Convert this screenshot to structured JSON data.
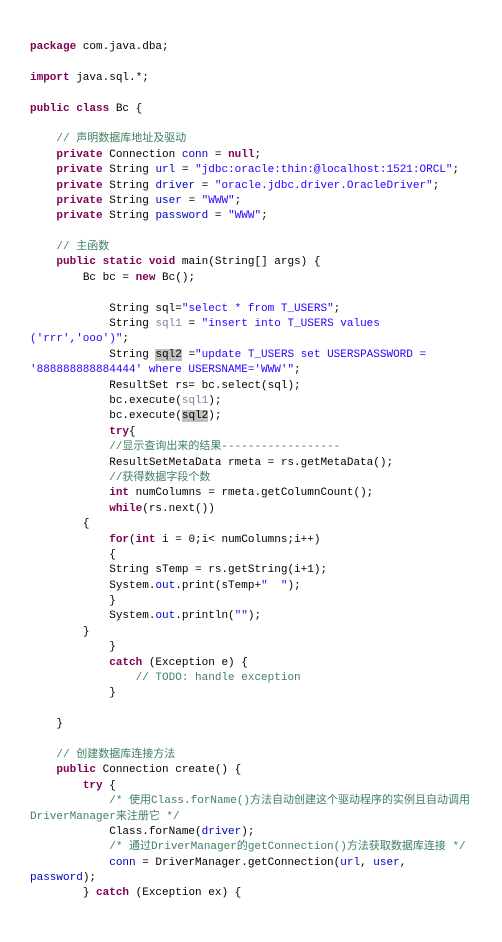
{
  "code": {
    "line1_pkg": "package",
    "line1_name": " com.java.dba;",
    "line2_imp": "import",
    "line2_name": " java.sql.*;",
    "line3_pub": "public",
    "line3_cls": " class",
    "line3_name": " Bc {",
    "c1": "    // 声明数据库地址及驱动",
    "p1a": "    private",
    "p1b": " Connection ",
    "p1c": "conn",
    "p1d": " = ",
    "p1e": "null",
    "p1f": ";",
    "p2a": "    private",
    "p2b": " String ",
    "p2c": "url",
    "p2d": " = ",
    "p2e": "\"jdbc:oracle:thin:@localhost:1521:ORCL\"",
    "p2f": ";",
    "p3a": "    private",
    "p3b": " String ",
    "p3c": "driver",
    "p3d": " = ",
    "p3e": "\"oracle.jdbc.driver.OracleDriver\"",
    "p3f": ";",
    "p4a": "    private",
    "p4b": " String ",
    "p4c": "user",
    "p4d": " = ",
    "p4e": "\"WWW\"",
    "p4f": ";",
    "p5a": "    private",
    "p5b": " String ",
    "p5c": "password",
    "p5d": " = ",
    "p5e": "\"WWW\"",
    "p5f": ";",
    "c2": "    // 主函数",
    "m1a": "    public",
    "m1b": " static",
    "m1c": " void",
    "m1d": " main(String[] args) {",
    "m2": "        Bc bc = ",
    "m2b": "new",
    "m2c": " Bc();",
    "s1a": "            String sql=",
    "s1b": "\"select * from T_USERS\"",
    "s1c": ";",
    "s2a": "            String ",
    "s2b": "sql1",
    "s2c": " = ",
    "s2d": "\"insert into T_USERS values ('rrr','ooo')\"",
    "s2e": ";",
    "s3a": "            String ",
    "s3b": "sql2",
    "s3c": " =",
    "s3d": "\"update T_USERS set USERSPASSWORD = '888888888884444' where USERSNAME='WWW'\"",
    "s3e": ";",
    "r1": "            ResultSet rs= bc.select(sql);",
    "r2a": "            bc.execute(",
    "r2b": "sql1",
    "r2c": ");",
    "r3a": "            bc.execute(",
    "r3b": "sql2",
    "r3c": ");",
    "t1a": "            try",
    "t1b": "{",
    "c3": "            //显示查询出来的结果------------------",
    "r4": "            ResultSetMetaData rmeta = rs.getMetaData();",
    "c4": "            //获得数据字段个数",
    "r5a": "            int",
    "r5b": " numColumns = rmeta.getColumnCount();",
    "r6a": "            while",
    "r6b": "(rs.next())",
    "b1": "        {",
    "f1a": "            for",
    "f1b": "(",
    "f1c": "int",
    "f1d": " i = 0;i< numColumns;i++)",
    "b2": "            {",
    "r7": "            String sTemp = rs.getString(i+1);",
    "r8a": "            System.",
    "r8b": "out",
    "r8c": ".print(sTemp+",
    "r8d": "\"  \"",
    "r8e": ");",
    "b3": "            }",
    "r9a": "            System.",
    "r9b": "out",
    "r9c": ".println(",
    "r9d": "\"\"",
    "r9e": ");",
    "b4": "        }",
    "b5": "            }",
    "ca1a": "            catch",
    "ca1b": " (Exception e) {",
    "c5": "                // TODO: handle exception",
    "b6": "            }",
    "b7": "    }",
    "c6": "    // 创建数据库连接方法",
    "cr1a": "    public",
    "cr1b": " Connection create() {",
    "cr2a": "        try",
    "cr2b": " {",
    "c7": "            /* 使用Class.forName()方法自动创建这个驱动程序的实例且自动调用DriverManager来注册它 */",
    "cr3a": "            Class.forName(",
    "cr3b": "driver",
    "cr3c": ");",
    "c8": "            /* 通过DriverManager的getConnection()方法获取数据库连接 */",
    "cr4a": "            ",
    "cr4b": "conn",
    "cr4c": " = DriverManager.getConnection(",
    "cr4d": "url",
    "cr4e": ", ",
    "cr4f": "user",
    "cr4g": ", ",
    "cr4h": "password",
    "cr4i": ");",
    "cr5a": "        } ",
    "cr5b": "catch",
    "cr5c": " (Exception ex) {"
  }
}
